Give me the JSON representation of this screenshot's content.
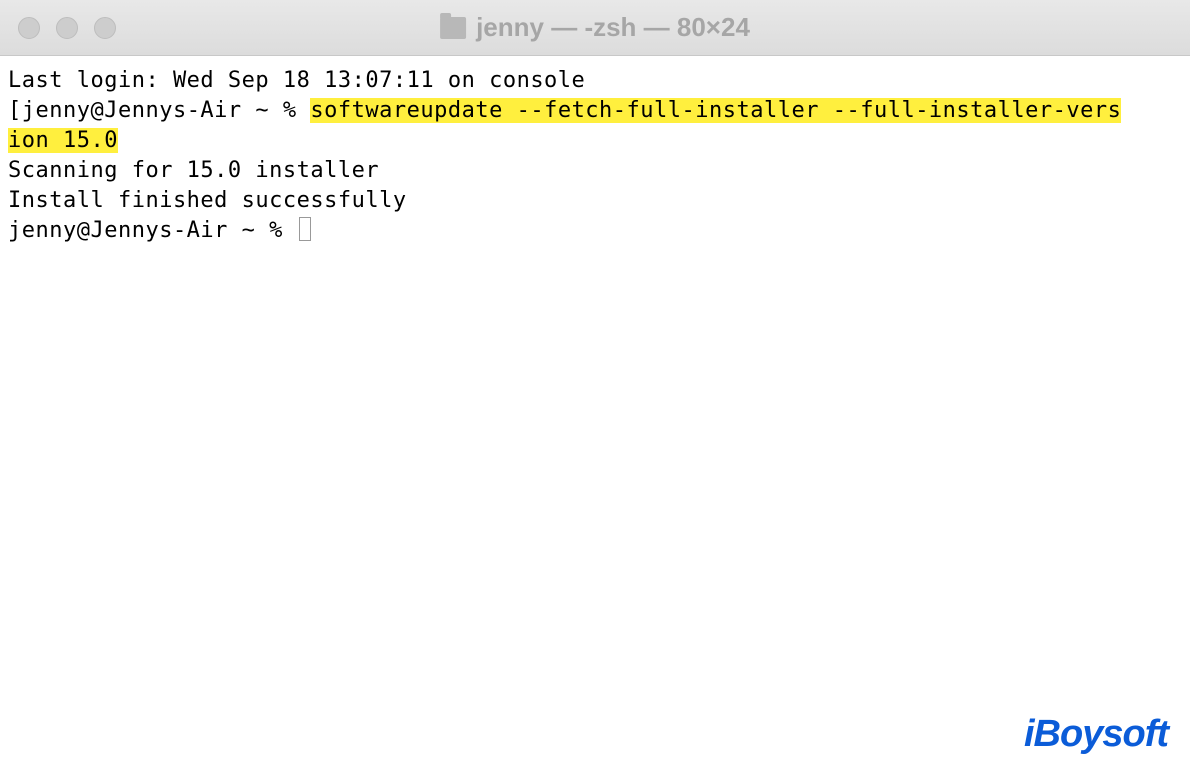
{
  "window": {
    "title": "jenny — -zsh — 80×24"
  },
  "terminal": {
    "last_login": "Last login: Wed Sep 18 13:07:11 on console",
    "prompt1": "jenny@Jennys-Air ~ % ",
    "cmd_part1": "softwareupdate --fetch-full-installer --full-installer-vers",
    "cmd_part2": "ion 15.0",
    "output1": "Scanning for 15.0 installer",
    "output2": "Install finished successfully",
    "prompt2": "jenny@Jennys-Air ~ % "
  },
  "watermark": "iBoysoft"
}
